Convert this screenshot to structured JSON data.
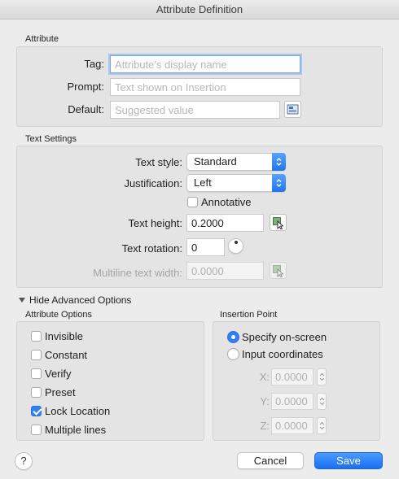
{
  "window": {
    "title": "Attribute Definition"
  },
  "attribute": {
    "heading": "Attribute",
    "tag_label": "Tag:",
    "tag_placeholder": "Attribute's display name",
    "prompt_label": "Prompt:",
    "prompt_placeholder": "Text shown on Insertion",
    "default_label": "Default:",
    "default_placeholder": "Suggested value"
  },
  "text_settings": {
    "heading": "Text Settings",
    "text_style_label": "Text style:",
    "text_style_value": "Standard",
    "justification_label": "Justification:",
    "justification_value": "Left",
    "annotative_label": "Annotative",
    "annotative_checked": false,
    "text_height_label": "Text height:",
    "text_height_value": "0.2000",
    "text_rotation_label": "Text rotation:",
    "text_rotation_value": "0",
    "multiline_label": "Multiline text width:",
    "multiline_value": "0.0000"
  },
  "advanced": {
    "toggle_label": "Hide Advanced Options"
  },
  "attribute_options": {
    "heading": "Attribute Options",
    "items": [
      {
        "label": "Invisible",
        "checked": false
      },
      {
        "label": "Constant",
        "checked": false
      },
      {
        "label": "Verify",
        "checked": false
      },
      {
        "label": "Preset",
        "checked": false
      },
      {
        "label": "Lock Location",
        "checked": true
      },
      {
        "label": "Multiple lines",
        "checked": false
      }
    ]
  },
  "insertion_point": {
    "heading": "Insertion Point",
    "specify_label": "Specify on-screen",
    "input_label": "Input coordinates",
    "selected": "specify",
    "x_label": "X:",
    "x_value": "0.0000",
    "y_label": "Y:",
    "y_value": "0.0000",
    "z_label": "Z:",
    "z_value": "0.0000"
  },
  "footer": {
    "help_label": "?",
    "cancel_label": "Cancel",
    "save_label": "Save"
  },
  "colors": {
    "accent": "#2f80f5",
    "background": "#ececec",
    "group": "#e4e4e4"
  }
}
